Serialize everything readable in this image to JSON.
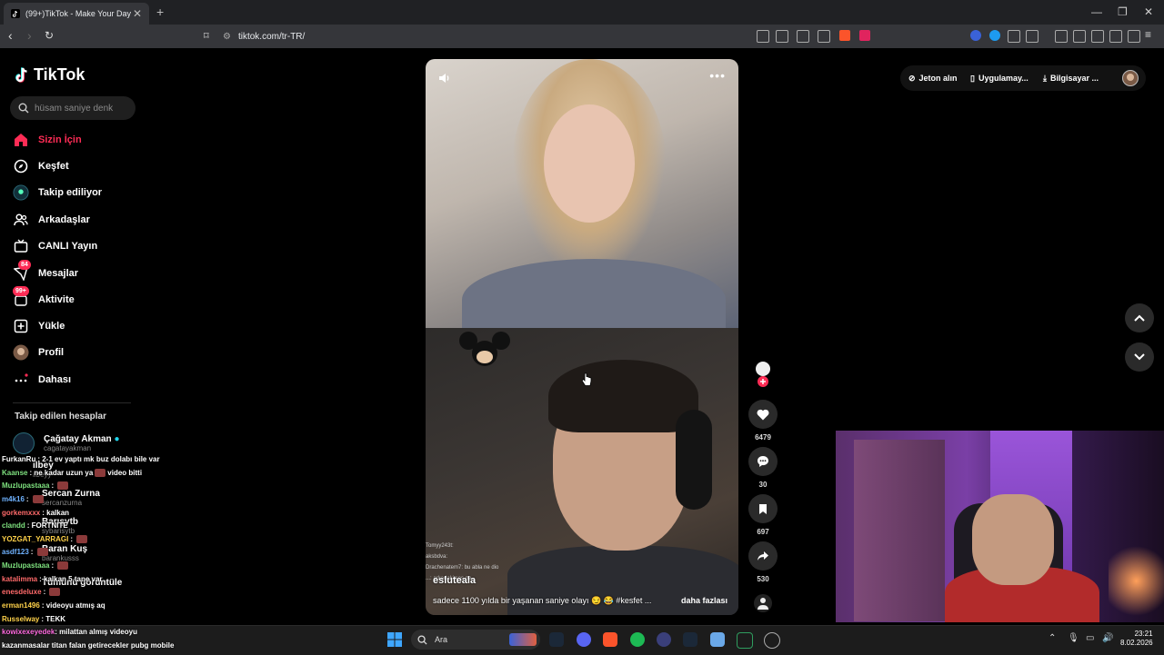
{
  "browser": {
    "tab_title": "(99+)TikTok - Make Your Day",
    "url": "tiktok.com/tr-TR/"
  },
  "sidebar": {
    "logo": "TikTok",
    "search_placeholder": "hüsam saniye denk",
    "nav": [
      {
        "label": "Sizin İçin",
        "icon": "home-icon",
        "active": true
      },
      {
        "label": "Keşfet",
        "icon": "compass-icon"
      },
      {
        "label": "Takip ediliyor",
        "icon": "following-icon"
      },
      {
        "label": "Arkadaşlar",
        "icon": "friends-icon"
      },
      {
        "label": "CANLI Yayın",
        "icon": "live-icon"
      },
      {
        "label": "Mesajlar",
        "icon": "messages-icon",
        "badge": "84"
      },
      {
        "label": "Aktivite",
        "icon": "activity-icon",
        "badge": "99+"
      },
      {
        "label": "Yükle",
        "icon": "upload-icon"
      },
      {
        "label": "Profil",
        "icon": "profile-icon"
      },
      {
        "label": "Dahası",
        "icon": "more-icon"
      }
    ],
    "following_title": "Takip edilen hesaplar",
    "following": [
      {
        "name": "Çağatay Akman",
        "handle": "cagatayakman",
        "verified": true
      },
      {
        "name": "ilbey",
        "handle": "ilbeyy"
      },
      {
        "name": "Sercan Zurna",
        "handle": "sercanzurna"
      },
      {
        "name": "Barışytb",
        "handle": "sybarisytb"
      },
      {
        "name": "Baran Kuş",
        "handle": "barankusss"
      }
    ],
    "see_all": "Tümünü görüntüle"
  },
  "chat": [
    {
      "user": "FurkanRu",
      "color": "#ffffff",
      "msg": "2-1 ev yaptı mk buz dolabı bile var"
    },
    {
      "user": "Kaanse",
      "color": "#ffffff",
      "msg": "ne kadar uzun ya",
      "emote": true,
      "msg2": "video bitti"
    },
    {
      "user": "Muzlupastaaa",
      "color": "#7ee07e",
      "msg": "",
      "emote": true
    },
    {
      "user": "m4k16",
      "color": "#6fb2ff",
      "msg": "",
      "emote": true
    },
    {
      "user": "gorkemxxx",
      "color": "#ff6a6a",
      "msg": "kalkan"
    },
    {
      "user": "clandd",
      "color": "#7ee07e",
      "msg": "FORTNITE"
    },
    {
      "user": "YOZGAT_YARRAGI",
      "color": "#ffd24a",
      "msg": "",
      "emote": true
    },
    {
      "user": "asdf123",
      "color": "#6fb2ff",
      "msg": "",
      "emote": true
    },
    {
      "user": "Muzlupastaaa",
      "color": "#7ee07e",
      "msg": "",
      "emote": true
    },
    {
      "user": "katalimma",
      "color": "#ff6a6a",
      "msg": "kalkan 5 tane var"
    },
    {
      "user": "enesdeluxe",
      "color": "#ff6a6a",
      "msg": "",
      "emote": true
    },
    {
      "user": "erman1496",
      "color": "#ffd24a",
      "msg": "videoyu atmış aq"
    },
    {
      "user": "Russelway",
      "color": "#ffd24a",
      "msg": "TEKK"
    },
    {
      "user": "kowixexeyedek",
      "color": "#ff6adf",
      "msg": "milattan almış videoyu"
    },
    {
      "user": "",
      "color": "#ffffff",
      "msg": "kazanmasalar titan falan getirecekler pubg mobile"
    }
  ],
  "video": {
    "username": "esluteala",
    "description": "sadece 1100 yılda bir yaşanan saniye olayı 😏 😂 #kesfet ...",
    "more_label": "daha fazlası",
    "overlay_chat": [
      "Tomyy243t:",
      "aksbdva:",
      "Drachenatem7: bu abla ne dio",
      "...: arkadaki ses ne"
    ]
  },
  "actions": {
    "likes": "6479",
    "comments": "30",
    "saves": "697",
    "shares": "530"
  },
  "topbar": {
    "coins": "Jeton alın",
    "app": "Uygulamay...",
    "pc": "Bilgisayar ..."
  },
  "taskbar": {
    "search": "Ara",
    "time": "23:21",
    "date": "8.02.2026"
  }
}
